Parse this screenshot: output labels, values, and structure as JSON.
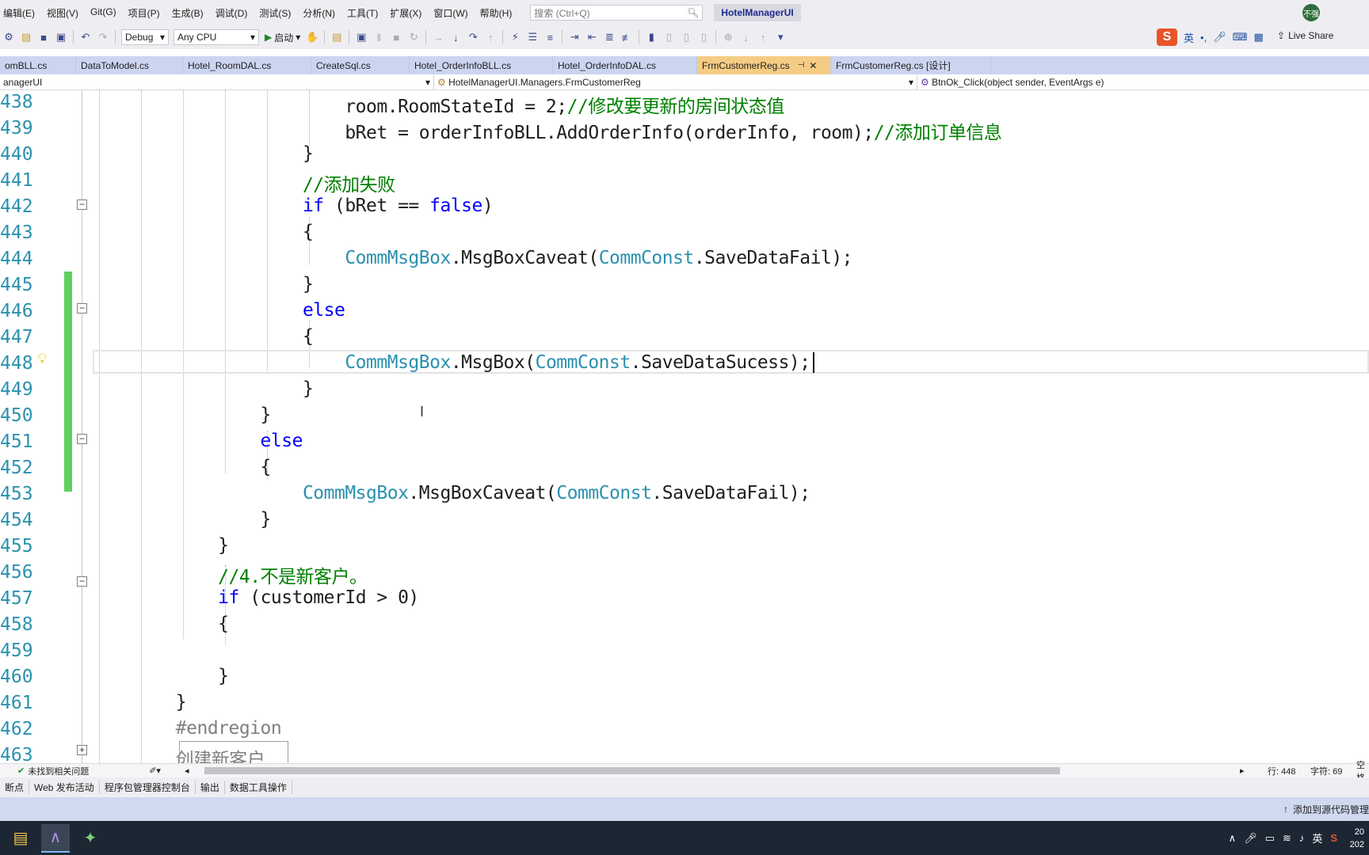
{
  "menu": {
    "items": [
      "编辑(E)",
      "视图(V)",
      "Git(G)",
      "项目(P)",
      "生成(B)",
      "调试(D)",
      "测试(S)",
      "分析(N)",
      "工具(T)",
      "扩展(X)",
      "窗口(W)",
      "帮助(H)"
    ],
    "search_placeholder": "搜索 (Ctrl+Q)",
    "app_title": "HotelManagerUI",
    "avatar_text": "不强"
  },
  "toolbar": {
    "config": "Debug",
    "platform": "Any CPU",
    "start_label": "启动",
    "ime_lang": "英",
    "live_share": "Live Share"
  },
  "tabs": [
    {
      "label": "omBLL.cs",
      "width": 96
    },
    {
      "label": "DataToModel.cs",
      "width": 135
    },
    {
      "label": "Hotel_RoomDAL.cs",
      "width": 162
    },
    {
      "label": "CreateSql.cs",
      "width": 124
    },
    {
      "label": "Hotel_OrderInfoBLL.cs",
      "width": 181
    },
    {
      "label": "Hotel_OrderInfoDAL.cs",
      "width": 182
    },
    {
      "label": "FrmCustomerReg.cs",
      "width": 169,
      "active": true
    },
    {
      "label": "FrmCustomerReg.cs [设计]",
      "width": 202
    }
  ],
  "nav": {
    "project": "anagerUI",
    "class": "HotelManagerUI.Managers.FrmCustomerReg",
    "member": "BtnOk_Click(object sender, EventArgs e)"
  },
  "code": [
    {
      "n": "438",
      "tokens": [
        [
          "pl",
          "                        room.RoomStateId = 2;"
        ],
        [
          "cm",
          "//修改要更新的房间状态值"
        ]
      ]
    },
    {
      "n": "439",
      "tokens": [
        [
          "pl",
          "                        bRet = orderInfoBLL.AddOrderInfo(orderInfo, room);"
        ],
        [
          "cm",
          "//添加订单信息"
        ]
      ]
    },
    {
      "n": "440",
      "tokens": [
        [
          "pl",
          "                    }"
        ]
      ]
    },
    {
      "n": "441",
      "tokens": [
        [
          "cm",
          "                    //添加失败"
        ]
      ]
    },
    {
      "n": "442",
      "tokens": [
        [
          "kw",
          "                    if"
        ],
        [
          "pl",
          " (bRet == "
        ],
        [
          "kw",
          "false"
        ],
        [
          "pl",
          ")"
        ]
      ]
    },
    {
      "n": "443",
      "tokens": [
        [
          "pl",
          "                    {"
        ]
      ]
    },
    {
      "n": "444",
      "tokens": [
        [
          "ty",
          "                        CommMsgBox"
        ],
        [
          "pl",
          ".MsgBoxCaveat("
        ],
        [
          "ty",
          "CommConst"
        ],
        [
          "pl",
          ".SaveDataFail);"
        ]
      ]
    },
    {
      "n": "445",
      "tokens": [
        [
          "pl",
          "                    }"
        ]
      ]
    },
    {
      "n": "446",
      "tokens": [
        [
          "kw",
          "                    else"
        ]
      ]
    },
    {
      "n": "447",
      "tokens": [
        [
          "pl",
          "                    {"
        ]
      ]
    },
    {
      "n": "448",
      "tokens": [
        [
          "ty",
          "                        CommMsgBox"
        ],
        [
          "pl",
          ".MsgBox("
        ],
        [
          "ty",
          "CommConst"
        ],
        [
          "pl",
          ".SaveDataSucess);"
        ]
      ]
    },
    {
      "n": "449",
      "tokens": [
        [
          "pl",
          "                    }"
        ]
      ]
    },
    {
      "n": "450",
      "tokens": [
        [
          "pl",
          "                }"
        ]
      ]
    },
    {
      "n": "451",
      "tokens": [
        [
          "kw",
          "                else"
        ]
      ]
    },
    {
      "n": "452",
      "tokens": [
        [
          "pl",
          "                {"
        ]
      ]
    },
    {
      "n": "453",
      "tokens": [
        [
          "ty",
          "                    CommMsgBox"
        ],
        [
          "pl",
          ".MsgBoxCaveat("
        ],
        [
          "ty",
          "CommConst"
        ],
        [
          "pl",
          ".SaveDataFail);"
        ]
      ]
    },
    {
      "n": "454",
      "tokens": [
        [
          "pl",
          "                }"
        ]
      ]
    },
    {
      "n": "455",
      "tokens": [
        [
          "pl",
          "            }"
        ]
      ]
    },
    {
      "n": "456",
      "tokens": [
        [
          "cm",
          "            //4.不是新客户。"
        ]
      ]
    },
    {
      "n": "457",
      "tokens": [
        [
          "kw",
          "            if"
        ],
        [
          "pl",
          " (customerId > 0)"
        ]
      ]
    },
    {
      "n": "458",
      "tokens": [
        [
          "pl",
          "            {"
        ]
      ]
    },
    {
      "n": "459",
      "tokens": [
        [
          "pl",
          ""
        ]
      ]
    },
    {
      "n": "460",
      "tokens": [
        [
          "pl",
          "            }"
        ]
      ]
    },
    {
      "n": "461",
      "tokens": [
        [
          "pl",
          "        }"
        ]
      ]
    },
    {
      "n": "462",
      "tokens": [
        [
          "pp",
          "        #endregion"
        ]
      ]
    },
    {
      "n": "463",
      "tokens": [
        [
          "pp",
          "        创建新客户"
        ]
      ]
    }
  ],
  "status": {
    "issues": "未找到相关问题",
    "line": "行: 448",
    "char": "字符: 69",
    "extra": "空格"
  },
  "bottom_tabs": [
    "断点",
    "Web 发布活动",
    "程序包管理器控制台",
    "输出",
    "数据工具操作"
  ],
  "source_control": "添加到源代码管理",
  "tray": {
    "lang": "英",
    "clock_time": "20",
    "clock_date": "202"
  }
}
